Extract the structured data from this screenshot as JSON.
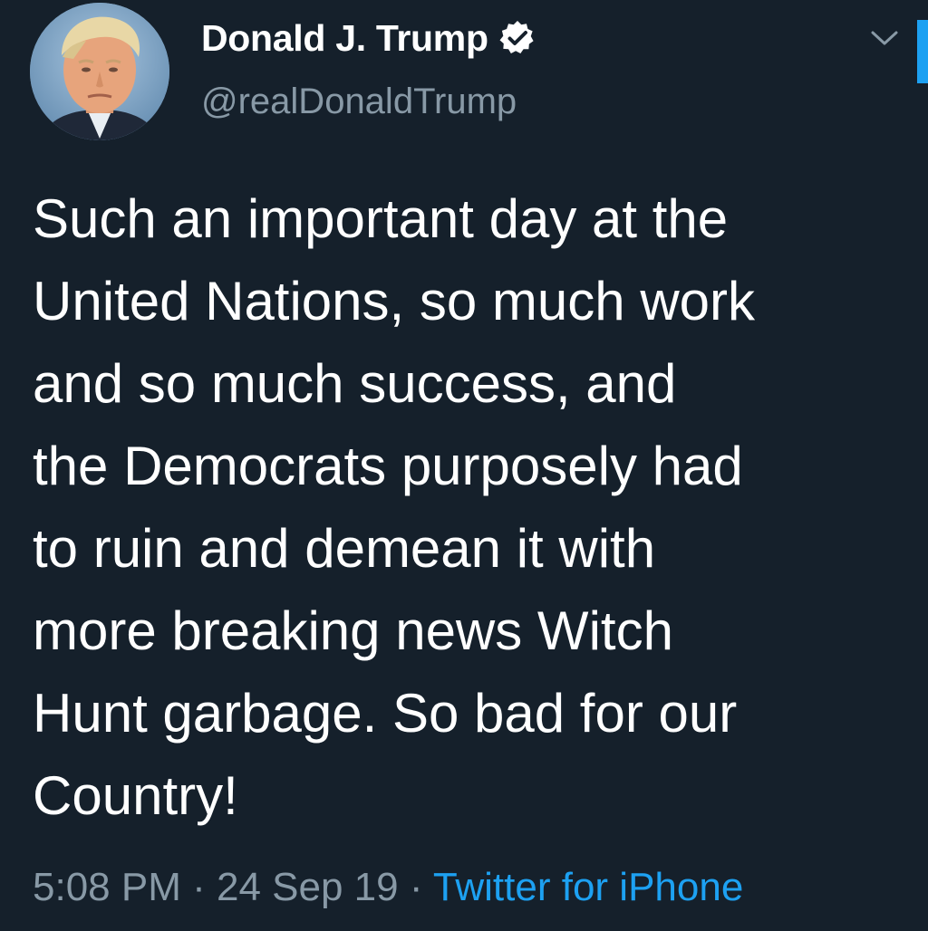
{
  "author": {
    "display_name": "Donald J. Trump",
    "handle": "@realDonaldTrump",
    "verified": true,
    "verified_icon": "verified-badge-icon",
    "avatar": "profile-avatar"
  },
  "menu": {
    "icon": "chevron-down-icon"
  },
  "tweet": {
    "lines": [
      "Such an important day at the",
      "United Nations, so much work",
      "and so much success, and",
      "the Democrats purposely had",
      "to ruin and demean it with",
      "more breaking news Witch",
      "Hunt garbage. So bad for our",
      "Country!"
    ]
  },
  "meta": {
    "time": "5:08 PM",
    "separator": " · ",
    "date": "24 Sep 19",
    "source": "Twitter for iPhone"
  },
  "colors": {
    "background": "#15202b",
    "text": "#ffffff",
    "secondary_text": "#8899a6",
    "accent": "#1da1f2"
  }
}
